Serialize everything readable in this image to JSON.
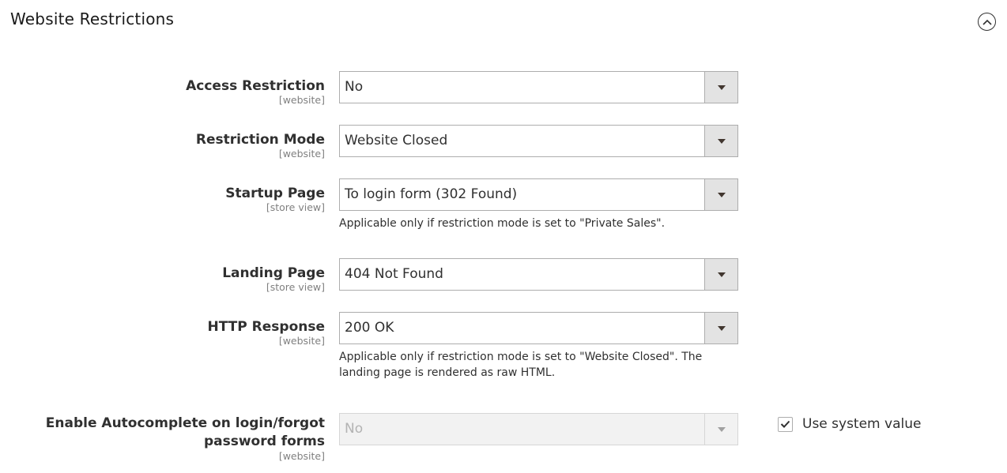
{
  "section": {
    "title": "Website Restrictions",
    "collapse_icon": "chevron-up-circle-icon"
  },
  "fields": [
    {
      "label": "Access Restriction",
      "scope": "[website]",
      "value": "No",
      "disabled": false
    },
    {
      "label": "Restriction Mode",
      "scope": "[website]",
      "value": "Website Closed",
      "disabled": false
    },
    {
      "label": "Startup Page",
      "scope": "[store view]",
      "value": "To login form (302 Found)",
      "note": "Applicable only if restriction mode is set to \"Private Sales\".",
      "disabled": false
    },
    {
      "label": "Landing Page",
      "scope": "[store view]",
      "value": "404 Not Found",
      "disabled": false
    },
    {
      "label": "HTTP Response",
      "scope": "[website]",
      "value": "200 OK",
      "note": "Applicable only if restriction mode is set to \"Website Closed\". The landing page is rendered as raw HTML.",
      "disabled": false
    },
    {
      "label": "Enable Autocomplete on login/forgot password forms",
      "scope": "[website]",
      "value": "No",
      "disabled": true,
      "use_system_value": {
        "label": "Use system value",
        "checked": true
      }
    }
  ]
}
